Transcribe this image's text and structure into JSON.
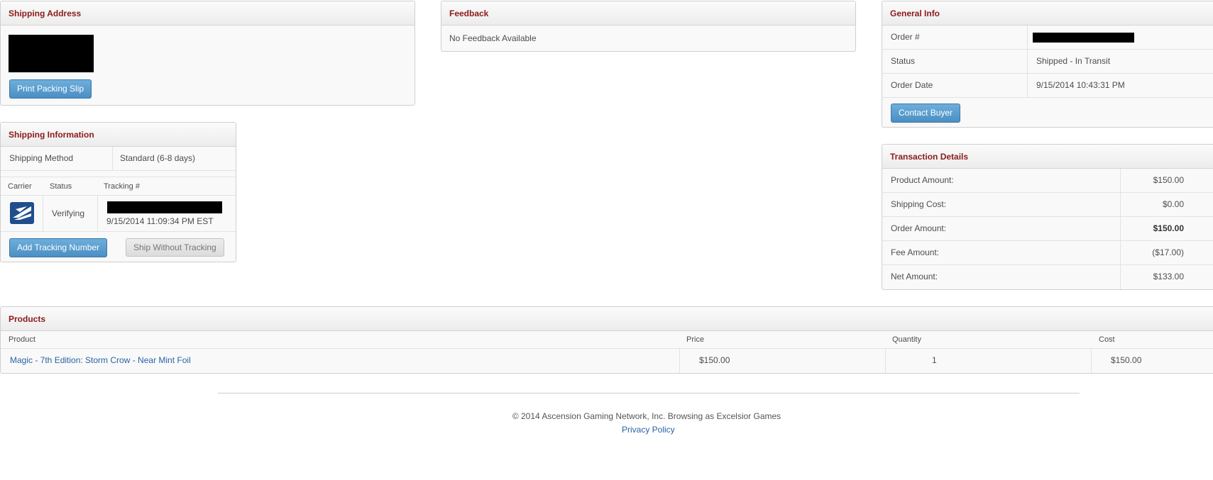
{
  "shipping_address": {
    "title": "Shipping Address",
    "print_button": "Print Packing Slip"
  },
  "feedback": {
    "title": "Feedback",
    "text": "No Feedback Available"
  },
  "general_info": {
    "title": "General Info",
    "rows": [
      {
        "label": "Order #",
        "value": ""
      },
      {
        "label": "Status",
        "value": "Shipped - In Transit"
      },
      {
        "label": "Order Date",
        "value": "9/15/2014 10:43:31 PM"
      }
    ],
    "contact_button": "Contact Buyer"
  },
  "shipping_info": {
    "title": "Shipping Information",
    "method_label": "Shipping Method",
    "method_value": "Standard (6-8 days)",
    "col_carrier": "Carrier",
    "col_status": "Status",
    "col_tracking": "Tracking #",
    "carrier_icon": "usps-eagle-icon",
    "status_value": "Verifying",
    "tracking_date": "9/15/2014 11:09:34 PM EST",
    "add_tracking_button": "Add Tracking Number",
    "ship_without_button": "Ship Without Tracking"
  },
  "transaction": {
    "title": "Transaction Details",
    "rows": [
      {
        "label": "Product Amount:",
        "value": "$150.00"
      },
      {
        "label": "Shipping Cost:",
        "value": "$0.00"
      },
      {
        "label": "Order Amount:",
        "value": "$150.00"
      },
      {
        "label": "Fee Amount:",
        "value": "($17.00)"
      },
      {
        "label": "Net Amount:",
        "value": "$133.00"
      }
    ]
  },
  "products": {
    "title": "Products",
    "headers": [
      "Product",
      "Price",
      "Quantity",
      "Cost"
    ],
    "rows": [
      {
        "product": "Magic - 7th Edition: Storm Crow - Near Mint Foil",
        "price": "$150.00",
        "quantity": "1",
        "cost": "$150.00"
      }
    ]
  },
  "footer": {
    "copyright": "© 2014 Ascension Gaming Network, Inc. Browsing as Excelsior Games",
    "privacy": "Privacy Policy"
  },
  "colors": {
    "heading": "#8b1b1b",
    "button_blue": "#4a8fc4",
    "link": "#2a62a6",
    "usps_blue": "#1f4e8c"
  }
}
